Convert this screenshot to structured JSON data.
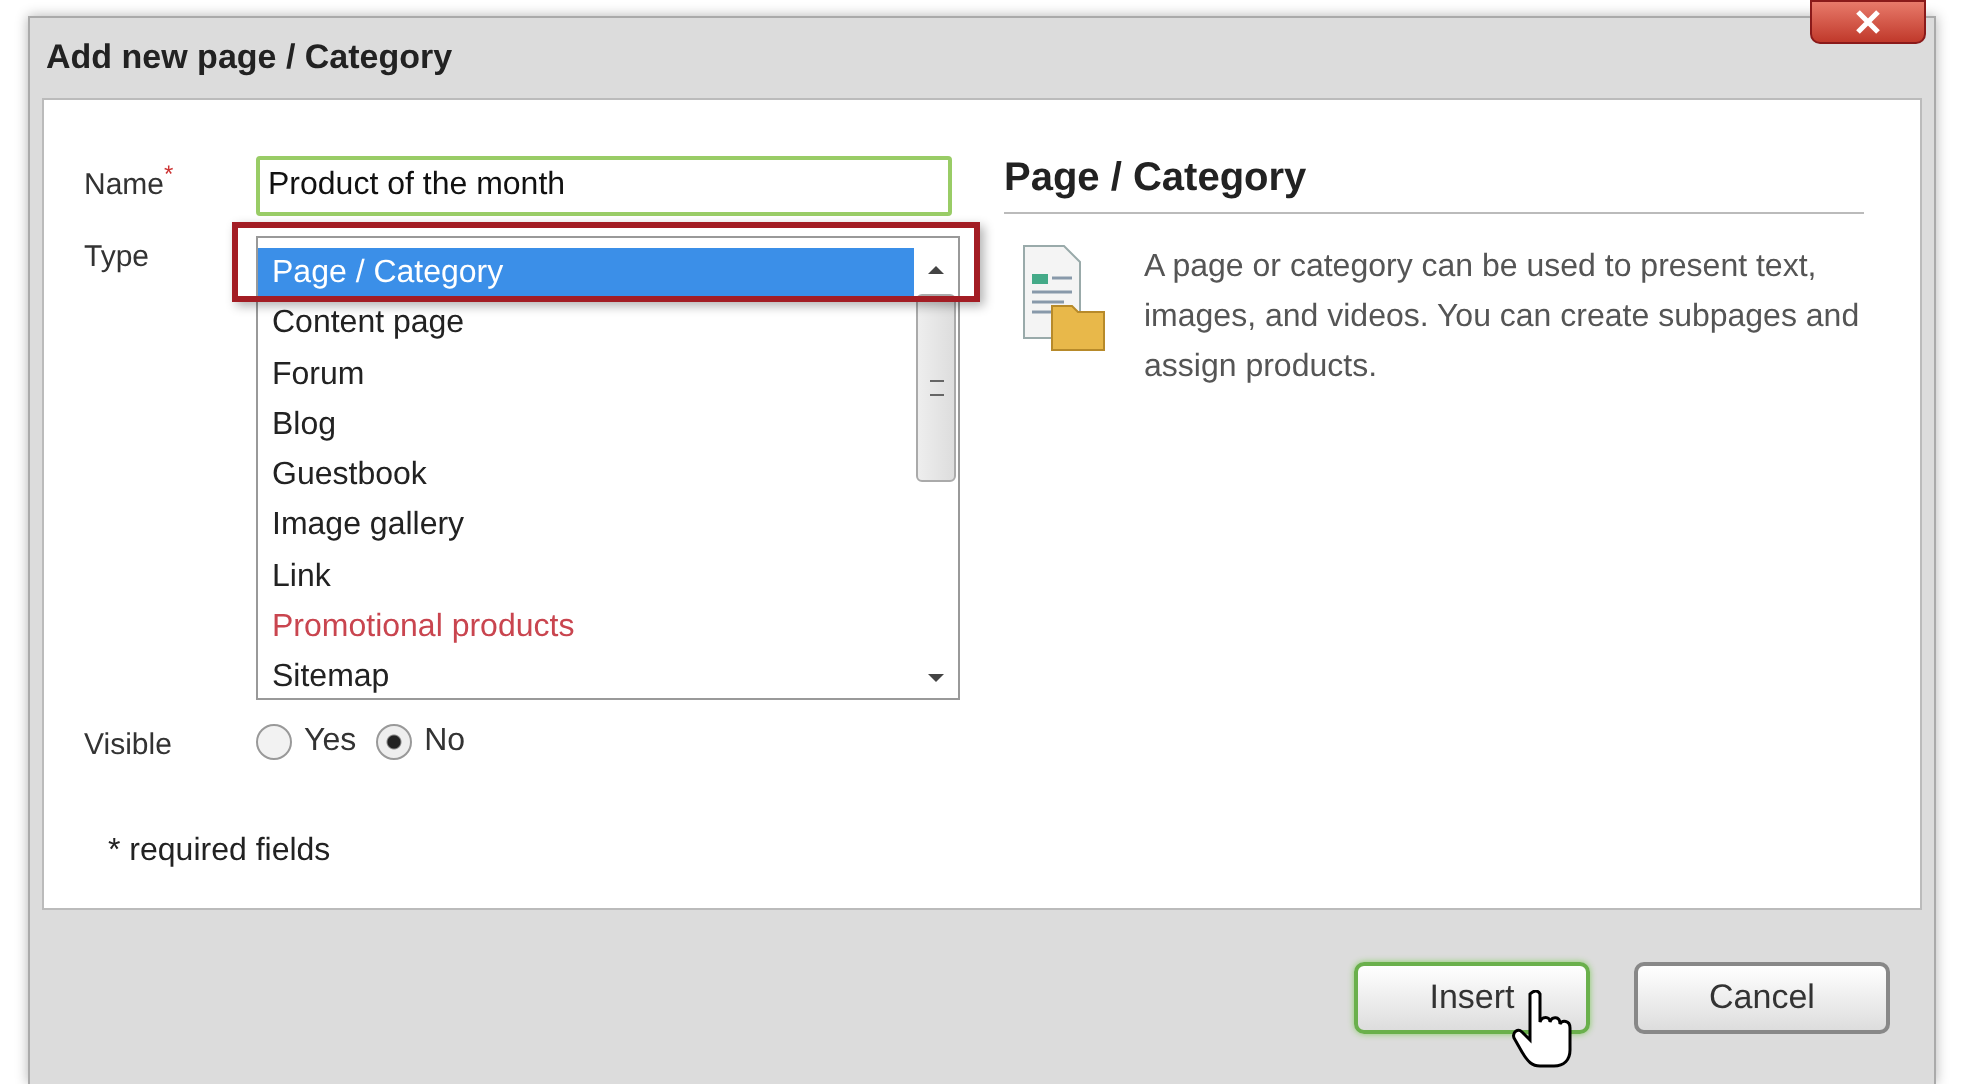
{
  "window": {
    "title": "Add new page / Category"
  },
  "form": {
    "name_label": "Name",
    "required_mark": "*",
    "name_value": "Product of the month",
    "type_label": "Type",
    "type_options": [
      {
        "label": "Page / Category",
        "selected": true,
        "kind": "normal"
      },
      {
        "label": "Content page",
        "selected": false,
        "kind": "normal"
      },
      {
        "label": "Forum",
        "selected": false,
        "kind": "normal"
      },
      {
        "label": "Blog",
        "selected": false,
        "kind": "normal"
      },
      {
        "label": "Guestbook",
        "selected": false,
        "kind": "normal"
      },
      {
        "label": "Image gallery",
        "selected": false,
        "kind": "normal"
      },
      {
        "label": "Link",
        "selected": false,
        "kind": "normal"
      },
      {
        "label": "Promotional products",
        "selected": false,
        "kind": "promo"
      },
      {
        "label": "Sitemap",
        "selected": false,
        "kind": "normal"
      }
    ],
    "visible_label": "Visible",
    "visible_options": [
      {
        "label": "Yes",
        "selected": false
      },
      {
        "label": "No",
        "selected": true
      }
    ],
    "required_note": "* required fields"
  },
  "info": {
    "heading": "Page / Category",
    "description": "A page or category can be used to present text, images, and videos. You can create subpages and assign products."
  },
  "buttons": [
    {
      "label": "Insert",
      "kind": "primary"
    },
    {
      "label": "Cancel",
      "kind": "secondary"
    }
  ]
}
